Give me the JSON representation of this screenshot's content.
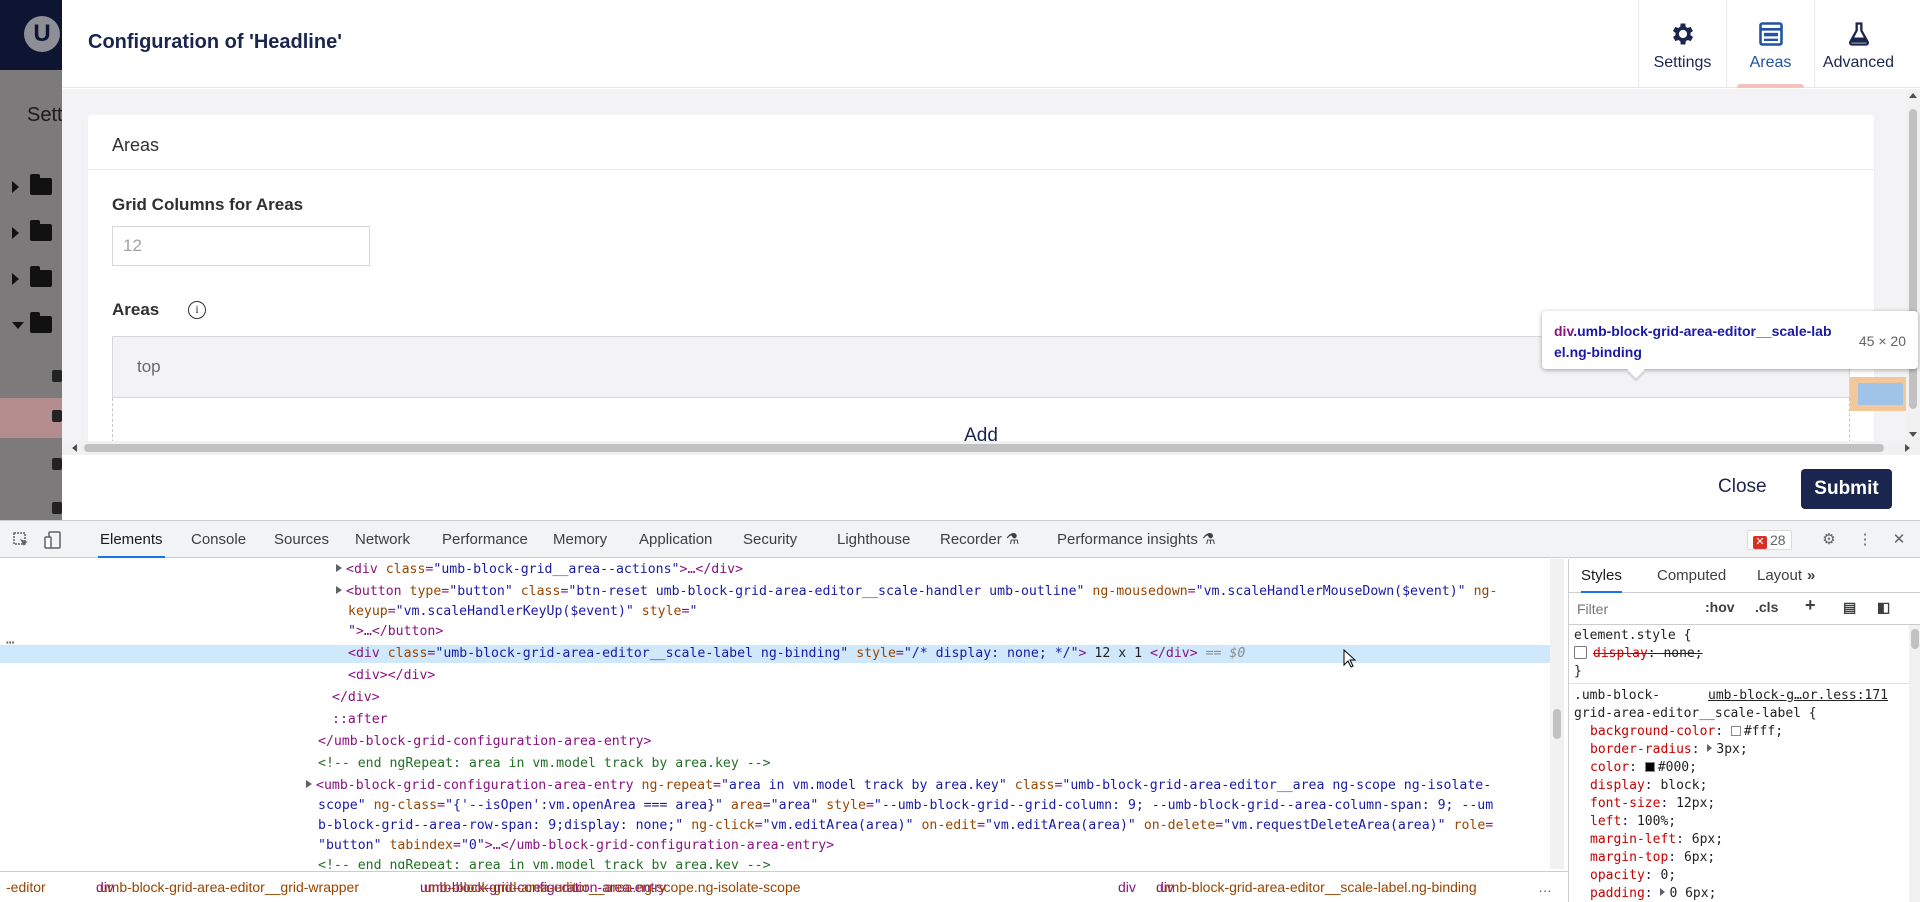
{
  "backdrop": {
    "section_label": "Sett"
  },
  "dialog": {
    "title": "Configuration of 'Headline'",
    "tabs": [
      {
        "label": "Settings",
        "icon": "gear-icon"
      },
      {
        "label": "Areas",
        "icon": "layout-icon",
        "active": true
      },
      {
        "label": "Advanced",
        "icon": "flask-icon"
      }
    ],
    "panel_title": "Areas",
    "grid_columns_label": "Grid Columns for Areas",
    "grid_columns_placeholder": "12",
    "areas_label": "Areas",
    "area_item": "top",
    "add_label": "Add",
    "close_label": "Close",
    "submit_label": "Submit"
  },
  "tooltip": {
    "tag": "div",
    "classes": ".umb-block-grid-area-editor__scale-label.ng-binding",
    "size": "45 × 20"
  },
  "devtools": {
    "tabs": [
      "Elements",
      "Console",
      "Sources",
      "Network",
      "Performance",
      "Memory",
      "Application",
      "Security",
      "Lighthouse",
      "Recorder",
      "Performance insights"
    ],
    "active_tab": "Elements",
    "error_count": "28",
    "dom_lines": {
      "l1_tag": "<div",
      "l1_attr": "class",
      "l1_val": "\"umb-block-grid__area--actions\"",
      "l1_rest": ">…</div>",
      "l2_tag": "<button",
      "l2_a1": "type",
      "l2_v1": "\"button\"",
      "l2_a2": "class",
      "l2_v2": "\"btn-reset umb-block-grid-area-editor__scale-handler umb-outline\"",
      "l2_a3": "ng-mousedown",
      "l2_v3": "\"vm.scaleHandlerMouseDown($event)\"",
      "l2_a4": "ng-",
      "l3_a4b": "keyup",
      "l3_v4": "\"vm.scaleHandlerKeyUp($event)\"",
      "l3_a5": "style",
      "l3_v5": "\"",
      "l4_v5b": "\"",
      "l4_rest": ">…</button>",
      "l5_tag": "<div",
      "l5_a1": "class",
      "l5_v1": "\"umb-block-grid-area-editor__scale-label ng-binding\"",
      "l5_a2": "style",
      "l5_v2": "\"/* display: none; */\"",
      "l5_text": " 12 x 1 ",
      "l5_close": "</div>",
      "l5_dollar": "== $0",
      "l6": "<div></div>",
      "l7": "</div>",
      "l8": "::after",
      "l9": "</umb-block-grid-configuration-area-entry>",
      "l10": "<!-- end ngRepeat: area in vm.model track by area.key -->",
      "l11_tag": "<umb-block-grid-configuration-area-entry",
      "l11_a1": "ng-repeat",
      "l11_v1": "\"area in vm.model track by area.key\"",
      "l11_a2": "class",
      "l11_v2": "\"umb-block-grid-area-editor__area ng-scope ng-isolate-",
      "l12_v2b": "scope\"",
      "l12_a3": "ng-class",
      "l12_v3": "\"{'--isOpen':vm.openArea === area}\"",
      "l12_a4": "area",
      "l12_v4": "\"area\"",
      "l12_a5": "style",
      "l12_v5": "\"--umb-block-grid--grid-column: 9; --umb-block-grid--area-column-span: 9; --um",
      "l13_v5b": "b-block-grid--area-row-span: 9;display: none;\"",
      "l13_a6": "ng-click",
      "l13_v6": "\"vm.editArea(area)\"",
      "l13_a7": "on-edit",
      "l13_v7": "\"vm.editArea(area)\"",
      "l13_a8": "on-delete",
      "l13_v8": "\"vm.requestDeleteArea(area)\"",
      "l13_a9": "role",
      "l13_eq": "=",
      "l14_v9": "\"button\"",
      "l14_a10": "tabindex",
      "l14_v10": "\"0\"",
      "l14_rest": ">…</umb-block-grid-configuration-area-entry>",
      "l15": "<!-- end ngRepeat: area in vm.model track by area.key -->"
    },
    "breadcrumbs": [
      {
        "tag": "",
        "cls": "-editor"
      },
      {
        "tag": "div",
        "cls": ".umb-block-grid-area-editor__grid-wrapper"
      },
      {
        "tag": "umb-block-grid-configuration-area-entry",
        "cls": ".umb-block-grid-area-editor__area.ng-scope.ng-isolate-scope"
      },
      {
        "tag": "div",
        "cls": ""
      },
      {
        "tag": "div",
        "cls": ".umb-block-grid-area-editor__scale-label.ng-binding"
      }
    ],
    "styles": {
      "tabs": [
        "Styles",
        "Computed",
        "Layout"
      ],
      "filter_placeholder": "Filter",
      "hov": ":hov",
      "cls": ".cls",
      "element_style_selector": "element.style {",
      "element_style_prop": "display",
      "element_style_val": "none;",
      "close_brace": "}",
      "rule_selector_1": ".umb-block-",
      "rule_selector_2": "grid-area-editor__scale-label {",
      "rule_source": "umb-block-g…or.less:171",
      "props": [
        {
          "name": "background-color",
          "value": "#fff;",
          "swatch": "#ffffff"
        },
        {
          "name": "border-radius",
          "value": "3px;",
          "expand": true
        },
        {
          "name": "color",
          "value": "#000;",
          "swatch": "#000000"
        },
        {
          "name": "display",
          "value": "block;"
        },
        {
          "name": "font-size",
          "value": "12px;"
        },
        {
          "name": "left",
          "value": "100%;"
        },
        {
          "name": "margin-left",
          "value": "6px;"
        },
        {
          "name": "margin-top",
          "value": "6px;"
        },
        {
          "name": "opacity",
          "value": "0;"
        },
        {
          "name": "padding",
          "value": "0 6px;",
          "expand": true
        }
      ]
    }
  }
}
